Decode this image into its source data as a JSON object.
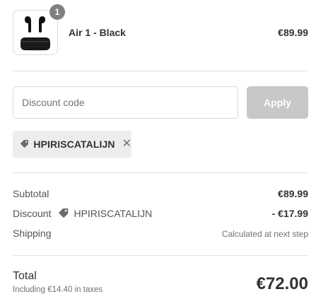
{
  "product": {
    "quantity": "1",
    "name": "Air 1 - Black",
    "price": "€89.99",
    "image_icon": "earbuds-case-icon"
  },
  "discount": {
    "placeholder": "Discount code",
    "apply_label": "Apply",
    "applied_code": "HPIRISCATALIJN",
    "tag_icon": "tag-icon",
    "remove_icon": "close-icon"
  },
  "summary": {
    "subtotal_label": "Subtotal",
    "subtotal_value": "€89.99",
    "discount_label": "Discount",
    "discount_code": "HPIRISCATALIJN",
    "discount_value": "- €17.99",
    "shipping_label": "Shipping",
    "shipping_value": "Calculated at next step"
  },
  "total": {
    "label": "Total",
    "tax_note": "Including €14.40 in taxes",
    "value": "€72.00"
  },
  "colors": {
    "apply_button_disabled": "#c8c8c8",
    "chip_background": "#ededed",
    "badge": "#7f7f7f",
    "divider": "#e1e1e1"
  }
}
